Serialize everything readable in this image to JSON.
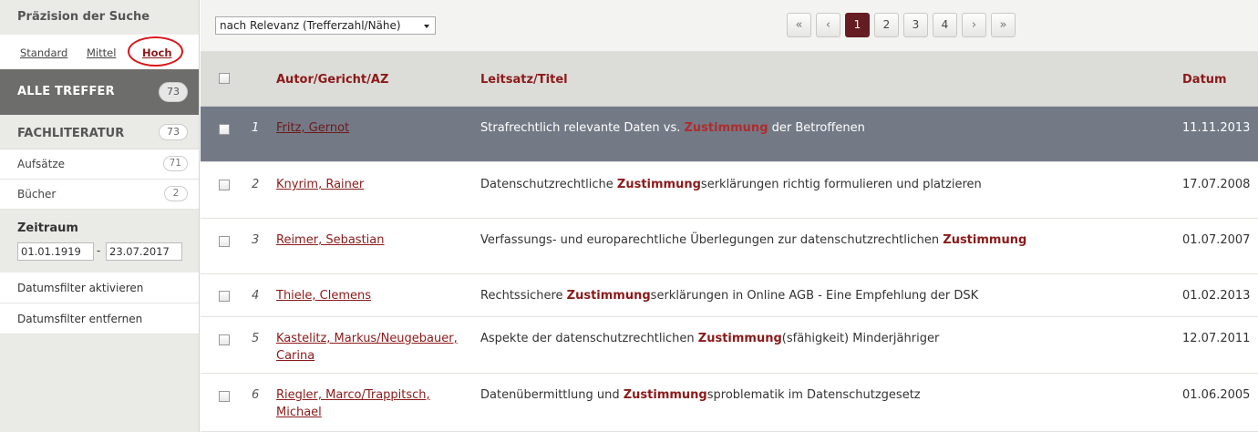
{
  "sidebar": {
    "precision": {
      "title": "Präzision der Suche",
      "options": [
        "Standard",
        "Mittel",
        "Hoch"
      ],
      "active": "Hoch"
    },
    "all_hits": {
      "label": "ALLE TREFFER",
      "count": "73"
    },
    "literature": {
      "label": "FACHLITERATUR",
      "count": "73"
    },
    "sub_items": [
      {
        "label": "Aufsätze",
        "count": "71"
      },
      {
        "label": "Bücher",
        "count": "2"
      }
    ],
    "period": {
      "label": "Zeitraum",
      "from": "01.01.1919",
      "to": "23.07.2017",
      "separator": "-"
    },
    "filters": {
      "activate": "Datumsfilter aktivieren",
      "remove": "Datumsfilter entfernen"
    }
  },
  "toolbar": {
    "sort_value": "nach Relevanz (Trefferzahl/Nähe)",
    "pager": {
      "first": "«",
      "prev": "‹",
      "pages": [
        "1",
        "2",
        "3",
        "4"
      ],
      "current": "1",
      "next": "›",
      "last": "»"
    }
  },
  "table": {
    "headers": {
      "author": "Autor/Gericht/AZ",
      "title": "Leitsatz/Titel",
      "date": "Datum"
    },
    "rows": [
      {
        "num": "1",
        "author": "Fritz, Gernot",
        "title_pre": "Strafrechtlich relevante Daten vs. ",
        "title_hl": "Zustimmung",
        "title_post": " der Betroffenen",
        "date": "11.11.2013"
      },
      {
        "num": "2",
        "author": "Knyrim, Rainer",
        "title_pre": "Datenschutzrechtliche ",
        "title_hl": "Zustimmung",
        "title_post": "serklärungen richtig formulieren und platzieren",
        "date": "17.07.2008"
      },
      {
        "num": "3",
        "author": "Reimer, Sebastian",
        "title_pre": "Verfassungs- und europarechtliche Überlegungen zur datenschutzrechtlichen ",
        "title_hl": "Zustimmung",
        "title_post": "",
        "date": "01.07.2007"
      },
      {
        "num": "4",
        "author": "Thiele, Clemens",
        "title_pre": "Rechtssichere ",
        "title_hl": "Zustimmung",
        "title_post": "serklärungen in Online AGB - Eine Empfehlung der DSK",
        "date": "01.02.2013"
      },
      {
        "num": "5",
        "author": "Kastelitz, Markus/Neugebauer, Carina",
        "title_pre": "Aspekte der datenschutzrechtlichen ",
        "title_hl": "Zustimmung",
        "title_post": "(sfähigkeit) Minderjähriger",
        "date": "12.07.2011"
      },
      {
        "num": "6",
        "author": "Riegler, Marco/Trappitsch, Michael",
        "title_pre": "Datenübermittlung und ",
        "title_hl": "Zustimmung",
        "title_post": "sproblematik im Datenschutzgesetz",
        "date": "01.06.2005"
      }
    ]
  },
  "colors": {
    "accent": "#8b1a1a",
    "selected_row": "#737a86",
    "active_page": "#651c22",
    "highlight_circle": "#d8171b"
  }
}
